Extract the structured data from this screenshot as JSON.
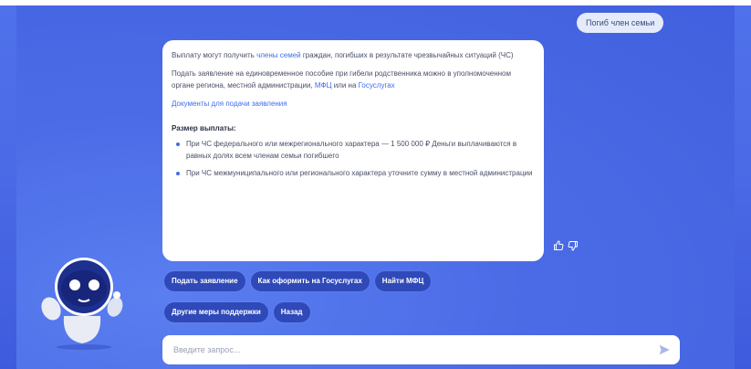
{
  "chat": {
    "user_message": "Погиб член семьи",
    "bot": {
      "p1_before": "Выплату могут получить ",
      "p1_link": "члены семей",
      "p1_after": " граждан, погибших в результате чрезвычайных ситуаций (ЧС)",
      "p2_text": "Подать заявление на единовременное пособие при гибели родственника можно в уполномоченном органе региона, местной администрации, ",
      "p2_link1": "МФЦ",
      "p2_mid": " или на ",
      "p2_link2": "Госуслугах",
      "documents_link": "Документы для подачи заявления",
      "payment_title": "Размер выплаты:",
      "bullet1": "При ЧС федерального или межрегионального характера — 1 500 000 ₽ Деньги выплачиваются в равных долях всем членам семьи погибшего",
      "bullet2": "При ЧС межмуниципального или регионального характера уточните сумму в местной администрации"
    }
  },
  "actions": {
    "submit": "Подать заявление",
    "gosuslugi": "Как оформить на Госуслугах",
    "find_mfc": "Найти МФЦ",
    "other_support": "Другие меры поддержки",
    "back": "Назад"
  },
  "input": {
    "placeholder": "Введите запрос..."
  },
  "colors": {
    "background": "#4b6be6",
    "chip": "#2f49b8",
    "link": "#3d6ef0"
  },
  "icons": [
    "thumbs-up-icon",
    "thumbs-down-icon",
    "send-icon",
    "robot-avatar"
  ]
}
